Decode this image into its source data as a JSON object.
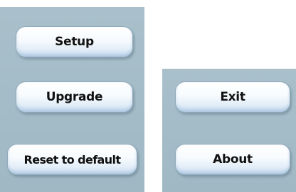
{
  "buttons": {
    "setup": "Setup",
    "upgrade": "Upgrade",
    "reset": "Reset to default",
    "exit": "Exit",
    "about": "About"
  },
  "colors": {
    "panel": "#a9c0cb",
    "button_border": "#8fa9bb",
    "text": "#111111"
  }
}
